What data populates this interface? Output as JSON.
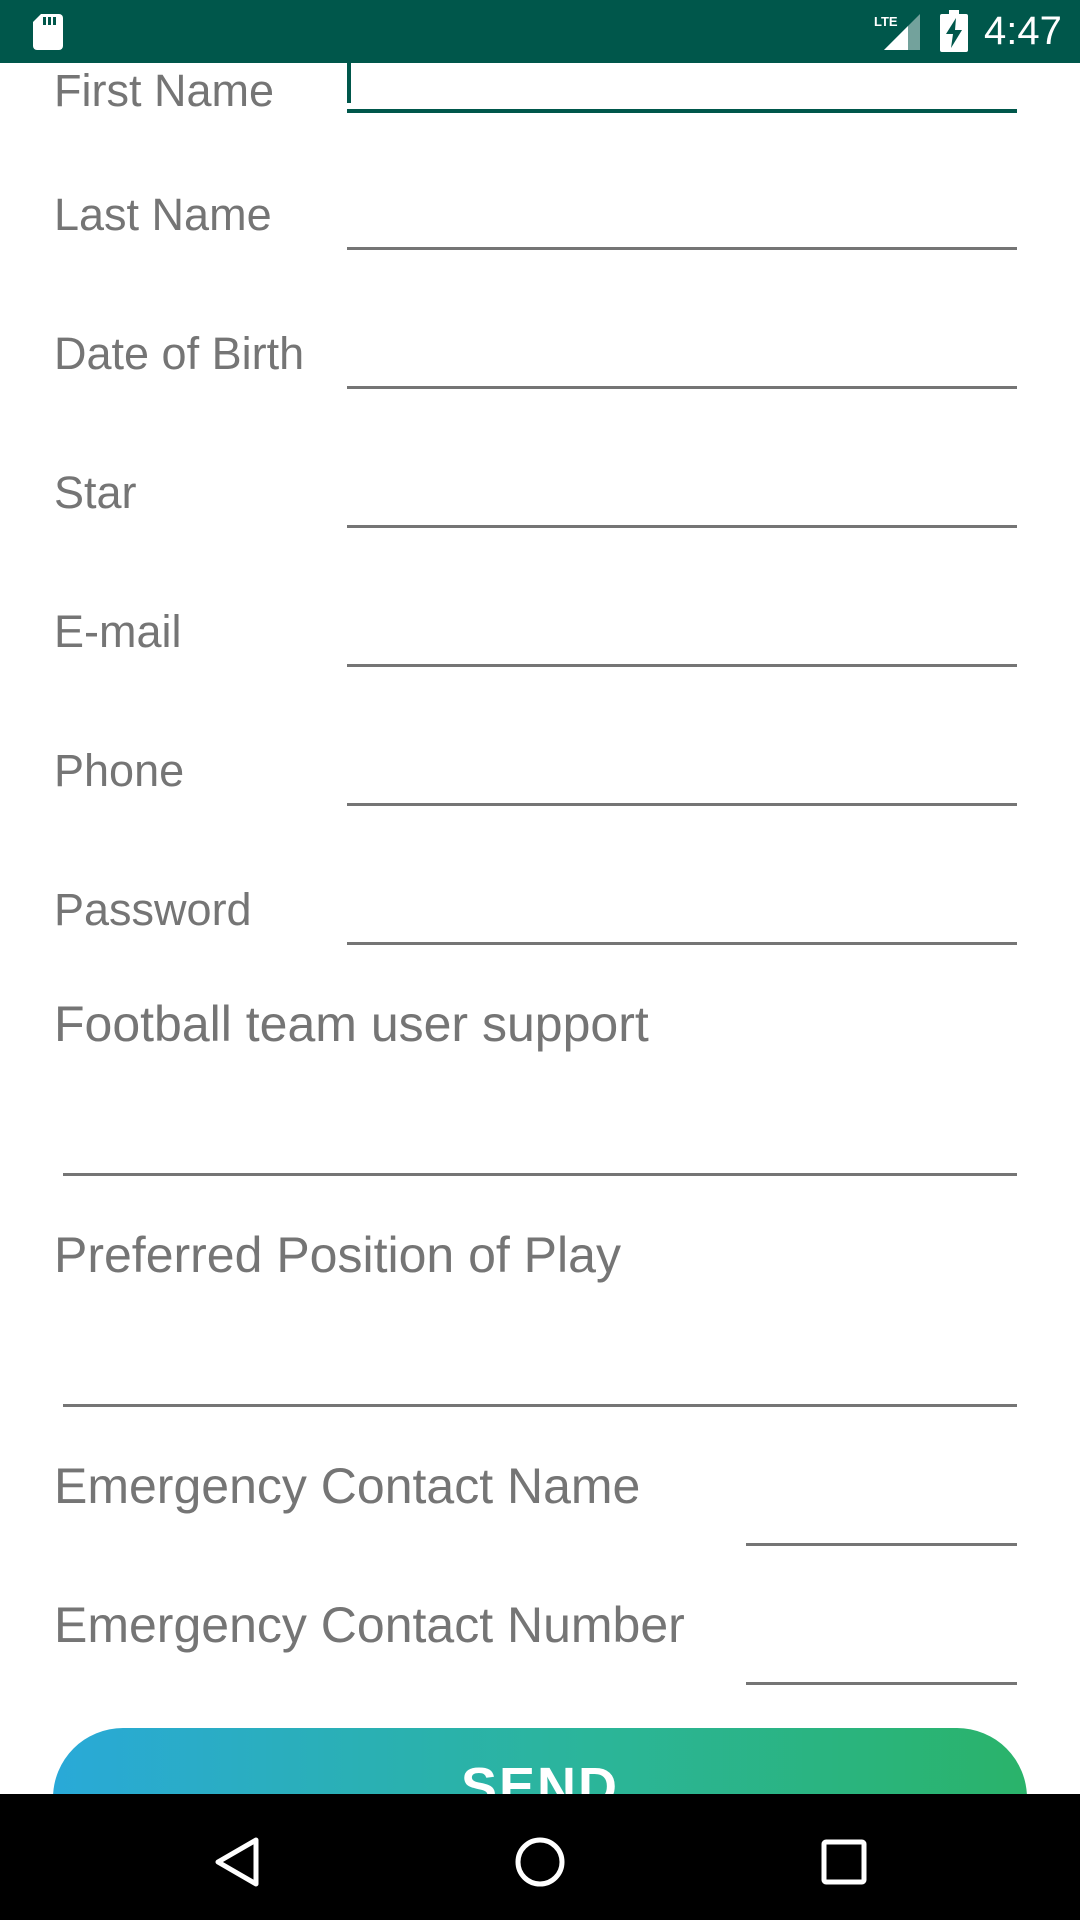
{
  "status_bar": {
    "time": "4:47",
    "network_label": "LTE",
    "icons": [
      "sd-card-icon",
      "lte-signal-icon",
      "battery-charging-icon"
    ],
    "background_color": "#00574b"
  },
  "form": {
    "fields": [
      {
        "label": "First Name",
        "value": "",
        "focused": true
      },
      {
        "label": "Last Name",
        "value": ""
      },
      {
        "label": "Date of Birth",
        "value": ""
      },
      {
        "label": "Star",
        "value": ""
      },
      {
        "label": "E-mail",
        "value": ""
      },
      {
        "label": "Phone",
        "value": ""
      },
      {
        "label": "Password",
        "value": ""
      },
      {
        "label": "Football team user support",
        "value": ""
      },
      {
        "label": "Preferred Position of Play",
        "value": ""
      },
      {
        "label": "Emergency Contact Name",
        "value": ""
      },
      {
        "label": "Emergency Contact Number",
        "value": ""
      }
    ],
    "accent_color": "#00574b",
    "send_label": "SEND"
  },
  "nav_bar": {
    "icons": [
      "back-icon",
      "home-icon",
      "recents-icon"
    ]
  }
}
